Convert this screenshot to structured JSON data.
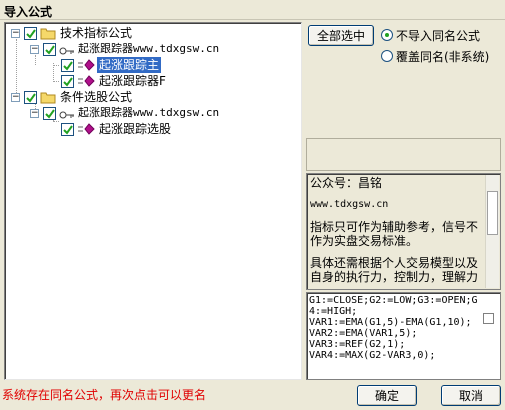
{
  "window": {
    "title": "导入公式"
  },
  "tree": {
    "items": [
      {
        "label": "技术指标公式"
      },
      {
        "label": "起涨跟踪器www.tdxgsw.cn"
      },
      {
        "label": "起涨跟踪主"
      },
      {
        "label": "起涨跟踪器F"
      },
      {
        "label": "条件选股公式"
      },
      {
        "label": "起涨跟踪器www.tdxgsw.cn"
      },
      {
        "label": "起涨跟踪选股"
      }
    ]
  },
  "actions": {
    "select_all": "全部选中",
    "ok": "确定",
    "cancel": "取消"
  },
  "options": {
    "no_import_same_name": "不导入同名公式",
    "overwrite_same_name": "覆盖同名(非系统)",
    "selected": "no_import_same_name"
  },
  "info": {
    "lines": [
      "公众号：昌铭",
      "",
      "www.tdxgsw.cn",
      "",
      "指标只可作为辅助参考，信号不作为实盘交易标准。",
      "",
      "具体还需根据个人交易模型以及自身的执行力，控制力，理解力"
    ]
  },
  "code": {
    "lines": [
      "G1:=CLOSE;G2:=LOW;G3:=OPEN;G",
      "4:=HIGH;",
      "VAR1:=EMA(G1,5)-EMA(G1,10);",
      "VAR2:=EMA(VAR1,5);",
      "VAR3:=REF(G2,1);",
      "VAR4:=MAX(G2-VAR3,0);"
    ]
  },
  "status": {
    "message": "系统存在同名公式，再次点击可以更名",
    "color": "#e00000"
  },
  "icons": {
    "folder": "folder-icon",
    "key": "key-icon",
    "formula": "formula-icon"
  }
}
